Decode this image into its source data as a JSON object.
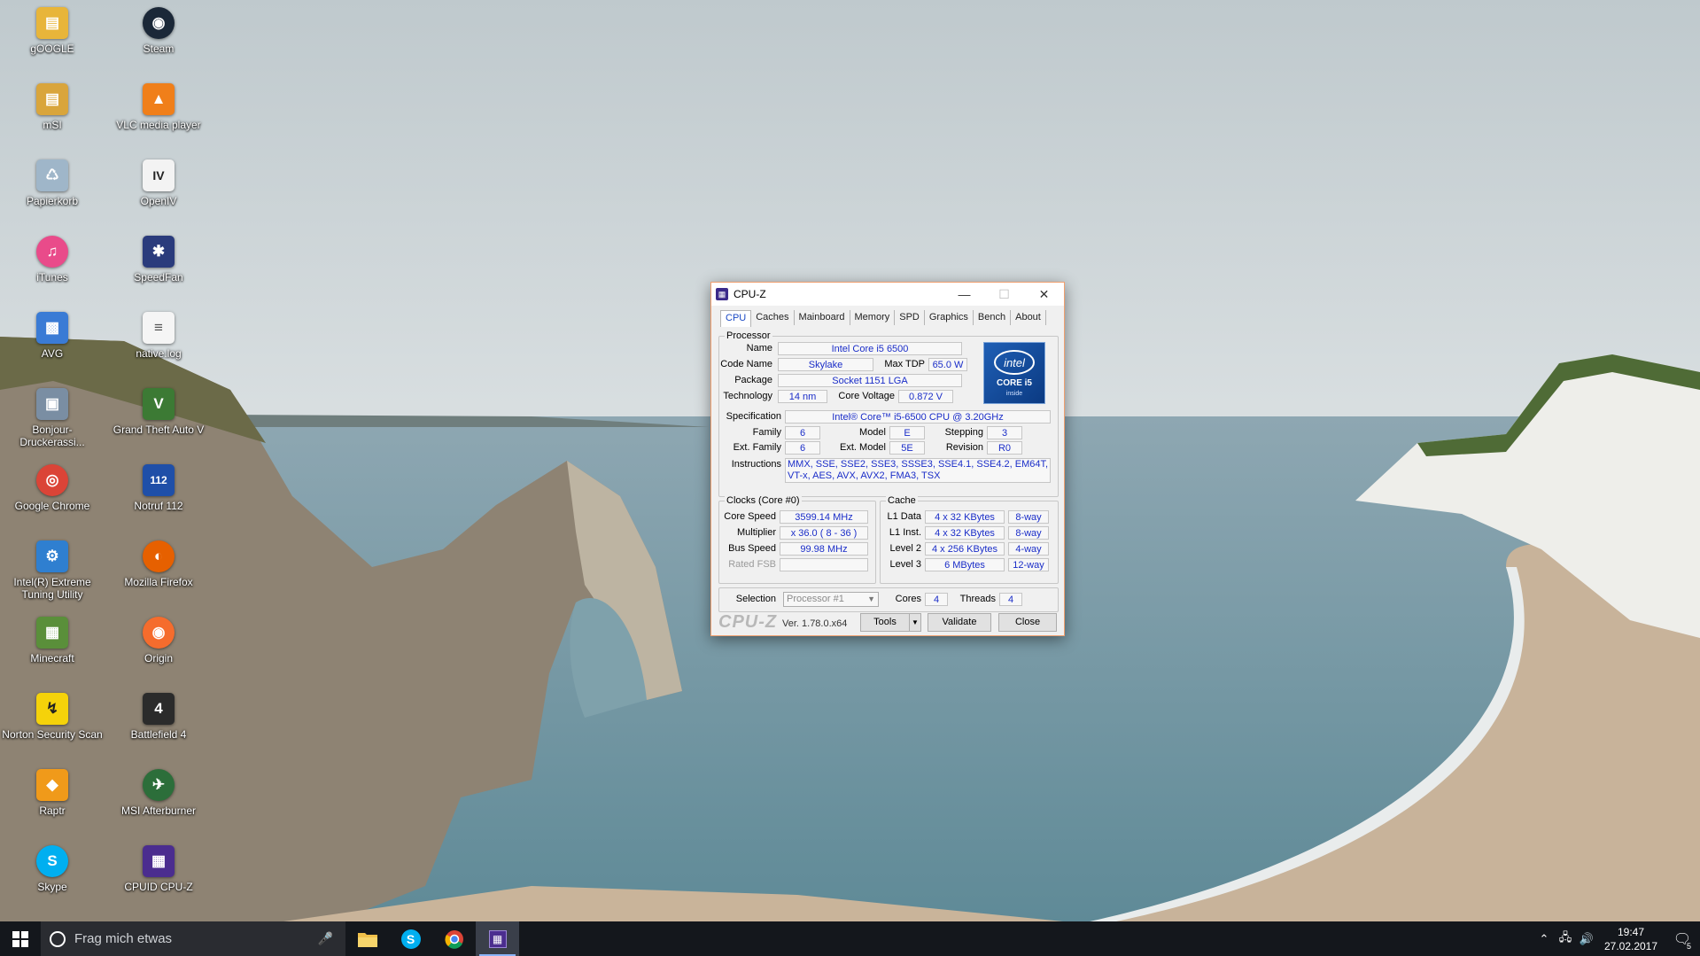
{
  "desktop": {
    "icons": [
      {
        "label": "gOOGLE",
        "color": "#e8b53a",
        "glyph": "▤"
      },
      {
        "label": "Steam",
        "color": "#1b2838",
        "glyph": "◉"
      },
      {
        "label": "mSI",
        "color": "#d9a53c",
        "glyph": "▤"
      },
      {
        "label": "VLC media player",
        "color": "#f07f1a",
        "glyph": "▲"
      },
      {
        "label": "Papierkorb",
        "color": "#9fb6c9",
        "glyph": "♺"
      },
      {
        "label": "OpenIV",
        "color": "#f3f3f3",
        "glyph": "IV"
      },
      {
        "label": "iTunes",
        "color": "#e94b8a",
        "glyph": "♫"
      },
      {
        "label": "SpeedFan",
        "color": "#2a3b7c",
        "glyph": "✱"
      },
      {
        "label": "AVG",
        "color": "#3a7bd5",
        "glyph": "▩"
      },
      {
        "label": "native.log",
        "color": "#f5f5f5",
        "glyph": "≡"
      },
      {
        "label": "Bonjour-Druckerassi...",
        "color": "#7a8ea3",
        "glyph": "▣"
      },
      {
        "label": "Grand Theft Auto V",
        "color": "#3c7a34",
        "glyph": "V"
      },
      {
        "label": "Google Chrome",
        "color": "#db4437",
        "glyph": "◎"
      },
      {
        "label": "Notruf 112",
        "color": "#1f4fa8",
        "glyph": "112"
      },
      {
        "label": "Intel(R) Extreme Tuning Utility",
        "color": "#2f7fd0",
        "glyph": "⚙"
      },
      {
        "label": "Mozilla Firefox",
        "color": "#e66000",
        "glyph": "◐"
      },
      {
        "label": "Minecraft",
        "color": "#5a8f3a",
        "glyph": "▦"
      },
      {
        "label": "Origin",
        "color": "#f56c2d",
        "glyph": "◉"
      },
      {
        "label": "Norton Security Scan",
        "color": "#f5d20a",
        "glyph": "↯"
      },
      {
        "label": "Battlefield 4",
        "color": "#2b2b2b",
        "glyph": "4"
      },
      {
        "label": "Raptr",
        "color": "#f09a1a",
        "glyph": "◆"
      },
      {
        "label": "MSI Afterburner",
        "color": "#2c6e3a",
        "glyph": "✈"
      },
      {
        "label": "Skype",
        "color": "#00aff0",
        "glyph": "S"
      },
      {
        "label": "CPUID CPU-Z",
        "color": "#4b2d8f",
        "glyph": "▦"
      }
    ]
  },
  "taskbar": {
    "search_placeholder": "Frag mich etwas",
    "clock_time": "19:47",
    "clock_date": "27.02.2017",
    "notification_count": "5"
  },
  "cpuz": {
    "window_title": "CPU-Z",
    "tabs": [
      "CPU",
      "Caches",
      "Mainboard",
      "Memory",
      "SPD",
      "Graphics",
      "Bench",
      "About"
    ],
    "processor_title": "Processor",
    "labels": {
      "name": "Name",
      "code_name": "Code Name",
      "max_tdp": "Max TDP",
      "package": "Package",
      "technology": "Technology",
      "core_voltage": "Core Voltage",
      "specification": "Specification",
      "family": "Family",
      "model": "Model",
      "stepping": "Stepping",
      "ext_family": "Ext. Family",
      "ext_model": "Ext. Model",
      "revision": "Revision",
      "instructions": "Instructions",
      "clocks_title": "Clocks (Core #0)",
      "core_speed": "Core Speed",
      "multiplier": "Multiplier",
      "bus_speed": "Bus Speed",
      "rated_fsb": "Rated FSB",
      "cache_title": "Cache",
      "l1_data": "L1 Data",
      "l1_inst": "L1 Inst.",
      "level2": "Level 2",
      "level3": "Level 3",
      "selection": "Selection",
      "cores": "Cores",
      "threads": "Threads"
    },
    "values": {
      "name": "Intel Core i5 6500",
      "code_name": "Skylake",
      "max_tdp": "65.0 W",
      "package": "Socket 1151 LGA",
      "technology": "14 nm",
      "core_voltage": "0.872 V",
      "specification": "Intel® Core™ i5-6500 CPU @ 3.20GHz",
      "family": "6",
      "model": "E",
      "stepping": "3",
      "ext_family": "6",
      "ext_model": "5E",
      "revision": "R0",
      "instructions": "MMX, SSE, SSE2, SSE3, SSSE3, SSE4.1, SSE4.2, EM64T, VT-x, AES, AVX, AVX2, FMA3, TSX",
      "core_speed": "3599.14 MHz",
      "multiplier": "x 36.0 ( 8 - 36 )",
      "bus_speed": "99.98 MHz",
      "rated_fsb": "",
      "l1_data": "4 x 32 KBytes",
      "l1_data_way": "8-way",
      "l1_inst": "4 x 32 KBytes",
      "l1_inst_way": "8-way",
      "level2": "4 x 256 KBytes",
      "level2_way": "4-way",
      "level3": "6 MBytes",
      "level3_way": "12-way",
      "selection": "Processor #1",
      "cores": "4",
      "threads": "4"
    },
    "logo": {
      "brand": "intel",
      "line": "CORE i5",
      "sub": "inside"
    },
    "footer": {
      "brand": "CPU-Z",
      "version": "Ver. 1.78.0.x64",
      "tools": "Tools",
      "validate": "Validate",
      "close": "Close"
    }
  }
}
